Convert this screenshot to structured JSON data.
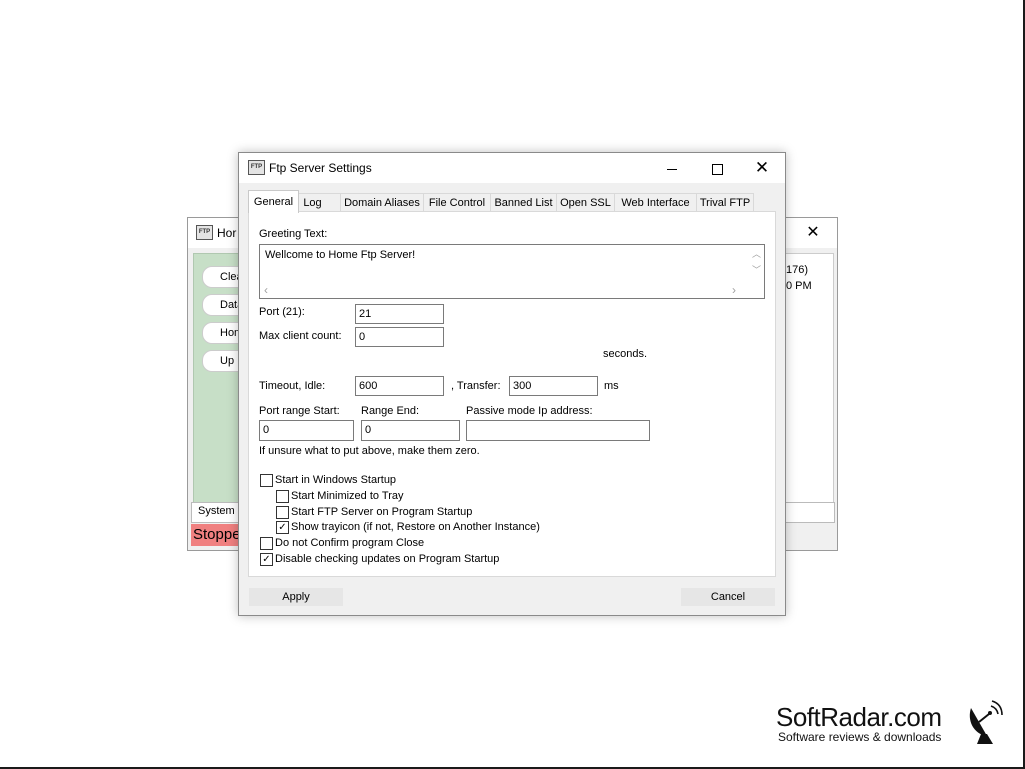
{
  "background_window": {
    "app_icon": "FTP",
    "title": "Hor",
    "close_glyph": "✕",
    "buttons": [
      "Clea",
      "Data",
      "Hom",
      "Up"
    ],
    "log_lines": [
      "176)",
      "0 PM"
    ],
    "tab_label": "System L",
    "status": "Stoppe"
  },
  "dialog": {
    "app_icon": "FTP",
    "title": "Ftp Server Settings",
    "close_glyph": "✕",
    "tabs": [
      "General",
      "Log",
      "Domain Aliases",
      "File Control",
      "Banned List",
      "Open SSL",
      "Web Interface",
      "Trival FTP"
    ],
    "active_tab": "General",
    "general": {
      "greeting_label": "Greeting Text:",
      "greeting_value": "Wellcome to Home Ftp Server!",
      "port_label": "Port (21):",
      "port_value": "21",
      "max_client_label": "Max client count:",
      "max_client_value": "0",
      "seconds_label": "seconds.",
      "timeout_label": "Timeout, Idle:",
      "timeout_idle_value": "600",
      "transfer_label": ", Transfer:",
      "transfer_value": "300",
      "ms_label": "ms",
      "port_range_start_label": "Port range Start:",
      "port_range_start_value": "0",
      "range_end_label": "Range End:",
      "range_end_value": "0",
      "passive_ip_label": "Passive mode Ip address:",
      "passive_ip_value": "",
      "hint": "If unsure what to put above, make them zero.",
      "checkboxes": [
        {
          "label": "Start in Windows Startup",
          "checked": false
        },
        {
          "label": "Start Minimized to Tray",
          "checked": false
        },
        {
          "label": "Start FTP Server on Program Startup",
          "checked": false
        },
        {
          "label": "Show trayicon (if not, Restore on Another Instance)",
          "checked": true
        },
        {
          "label": "Do not Confirm program Close",
          "checked": false
        },
        {
          "label": "Disable checking updates on Program Startup",
          "checked": true
        }
      ]
    },
    "apply_label": "Apply",
    "cancel_label": "Cancel"
  },
  "watermark": {
    "title": "SoftRadar.com",
    "subtitle": "Software reviews & downloads",
    "icon": "satellite-dish-icon"
  }
}
